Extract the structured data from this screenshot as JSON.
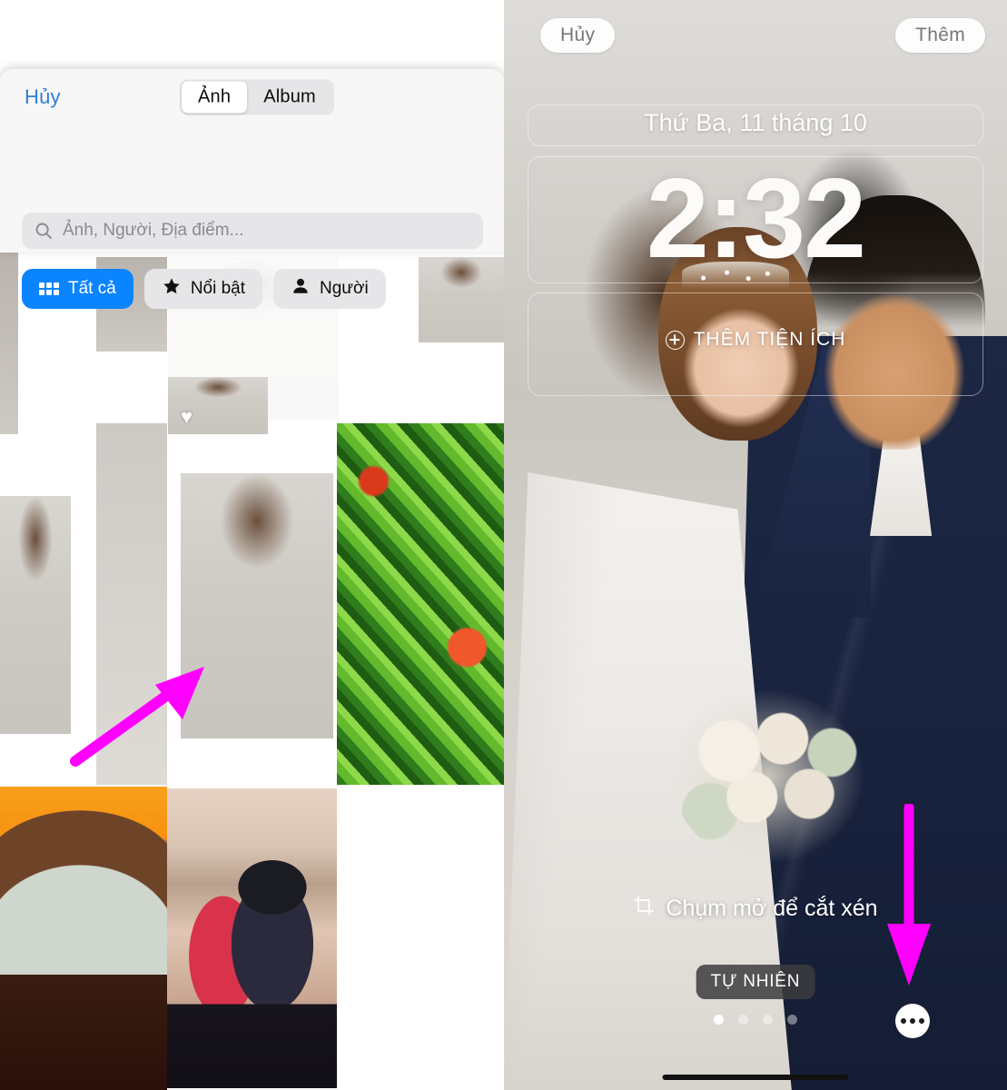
{
  "picker": {
    "cancel_label": "Hủy",
    "segments": [
      {
        "label": "Ảnh",
        "selected": true
      },
      {
        "label": "Album",
        "selected": false
      }
    ],
    "search": {
      "placeholder": "Ảnh, Người, Địa điểm...",
      "icon": "search-icon",
      "value": ""
    },
    "filters": [
      {
        "label": "Tất cả",
        "icon": "grid-icon",
        "selected": true
      },
      {
        "label": "Nổi bật",
        "icon": "star-icon",
        "selected": false
      },
      {
        "label": "Người",
        "icon": "person-icon",
        "selected": false
      }
    ],
    "favorite_badge": "♥",
    "accent_color": "#0a84ff",
    "link_color": "#2e7fd6"
  },
  "lockscreen": {
    "cancel_label": "Hủy",
    "add_label": "Thêm",
    "date": "Thứ Ba, 11 tháng 10",
    "time": "2:32",
    "add_widget_label": "THÊM TIỆN ÍCH",
    "add_widget_icon": "plus-circle-icon",
    "pinch_hint": "Chụm mở để cắt xén",
    "pinch_icon": "crop-icon",
    "style_chip": "TỰ NHIÊN",
    "photo_stack_icon": "photo-stack-icon",
    "more_icon": "more-ellipsis-icon",
    "page_dots": [
      {
        "active": true
      },
      {
        "active": false
      },
      {
        "active": false
      },
      {
        "active": false
      }
    ]
  },
  "annotations": {
    "arrow_color": "#ff00ff",
    "left_arrow_name": "arrow-pointing-to-photo",
    "right_arrow_name": "arrow-pointing-to-more-button"
  }
}
